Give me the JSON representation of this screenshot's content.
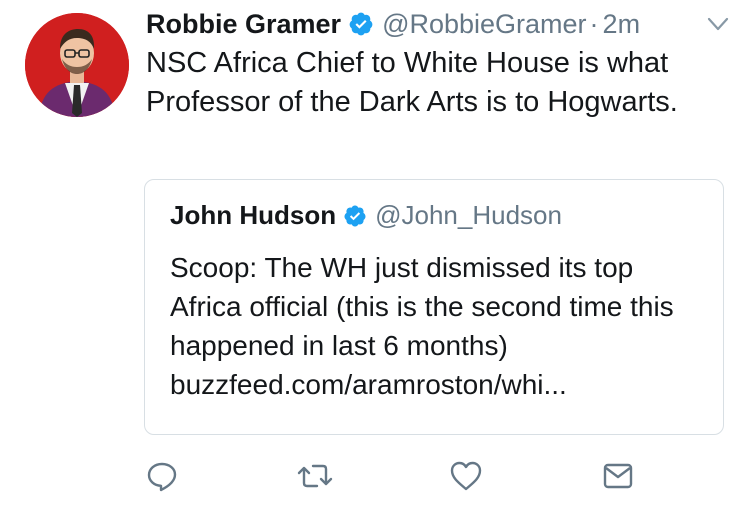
{
  "tweet": {
    "author_name": "Robbie Gramer",
    "author_handle": "@RobbieGramer",
    "separator": "·",
    "timestamp": "2m",
    "verified": true,
    "text": "NSC Africa Chief to White House is what Professor of the Dark Arts is to Hogwarts."
  },
  "quoted_tweet": {
    "author_name": "John Hudson",
    "author_handle": "@John_Hudson",
    "verified": true,
    "text": "Scoop: The WH just dismissed its top Africa official (this is the second time this happened in last 6 months)",
    "link": "buzzfeed.com/aramroston/whi..."
  },
  "actions": [
    {
      "name": "reply",
      "icon": "reply-icon"
    },
    {
      "name": "retweet",
      "icon": "retweet-icon"
    },
    {
      "name": "like",
      "icon": "heart-icon"
    },
    {
      "name": "direct-message",
      "icon": "envelope-icon"
    }
  ],
  "colors": {
    "text_primary": "#14171a",
    "text_secondary": "#657786",
    "verified_blue": "#1da1f2",
    "border": "#d8dfe4",
    "icon_gray": "#657786",
    "avatar_background": "#d01f1f"
  }
}
